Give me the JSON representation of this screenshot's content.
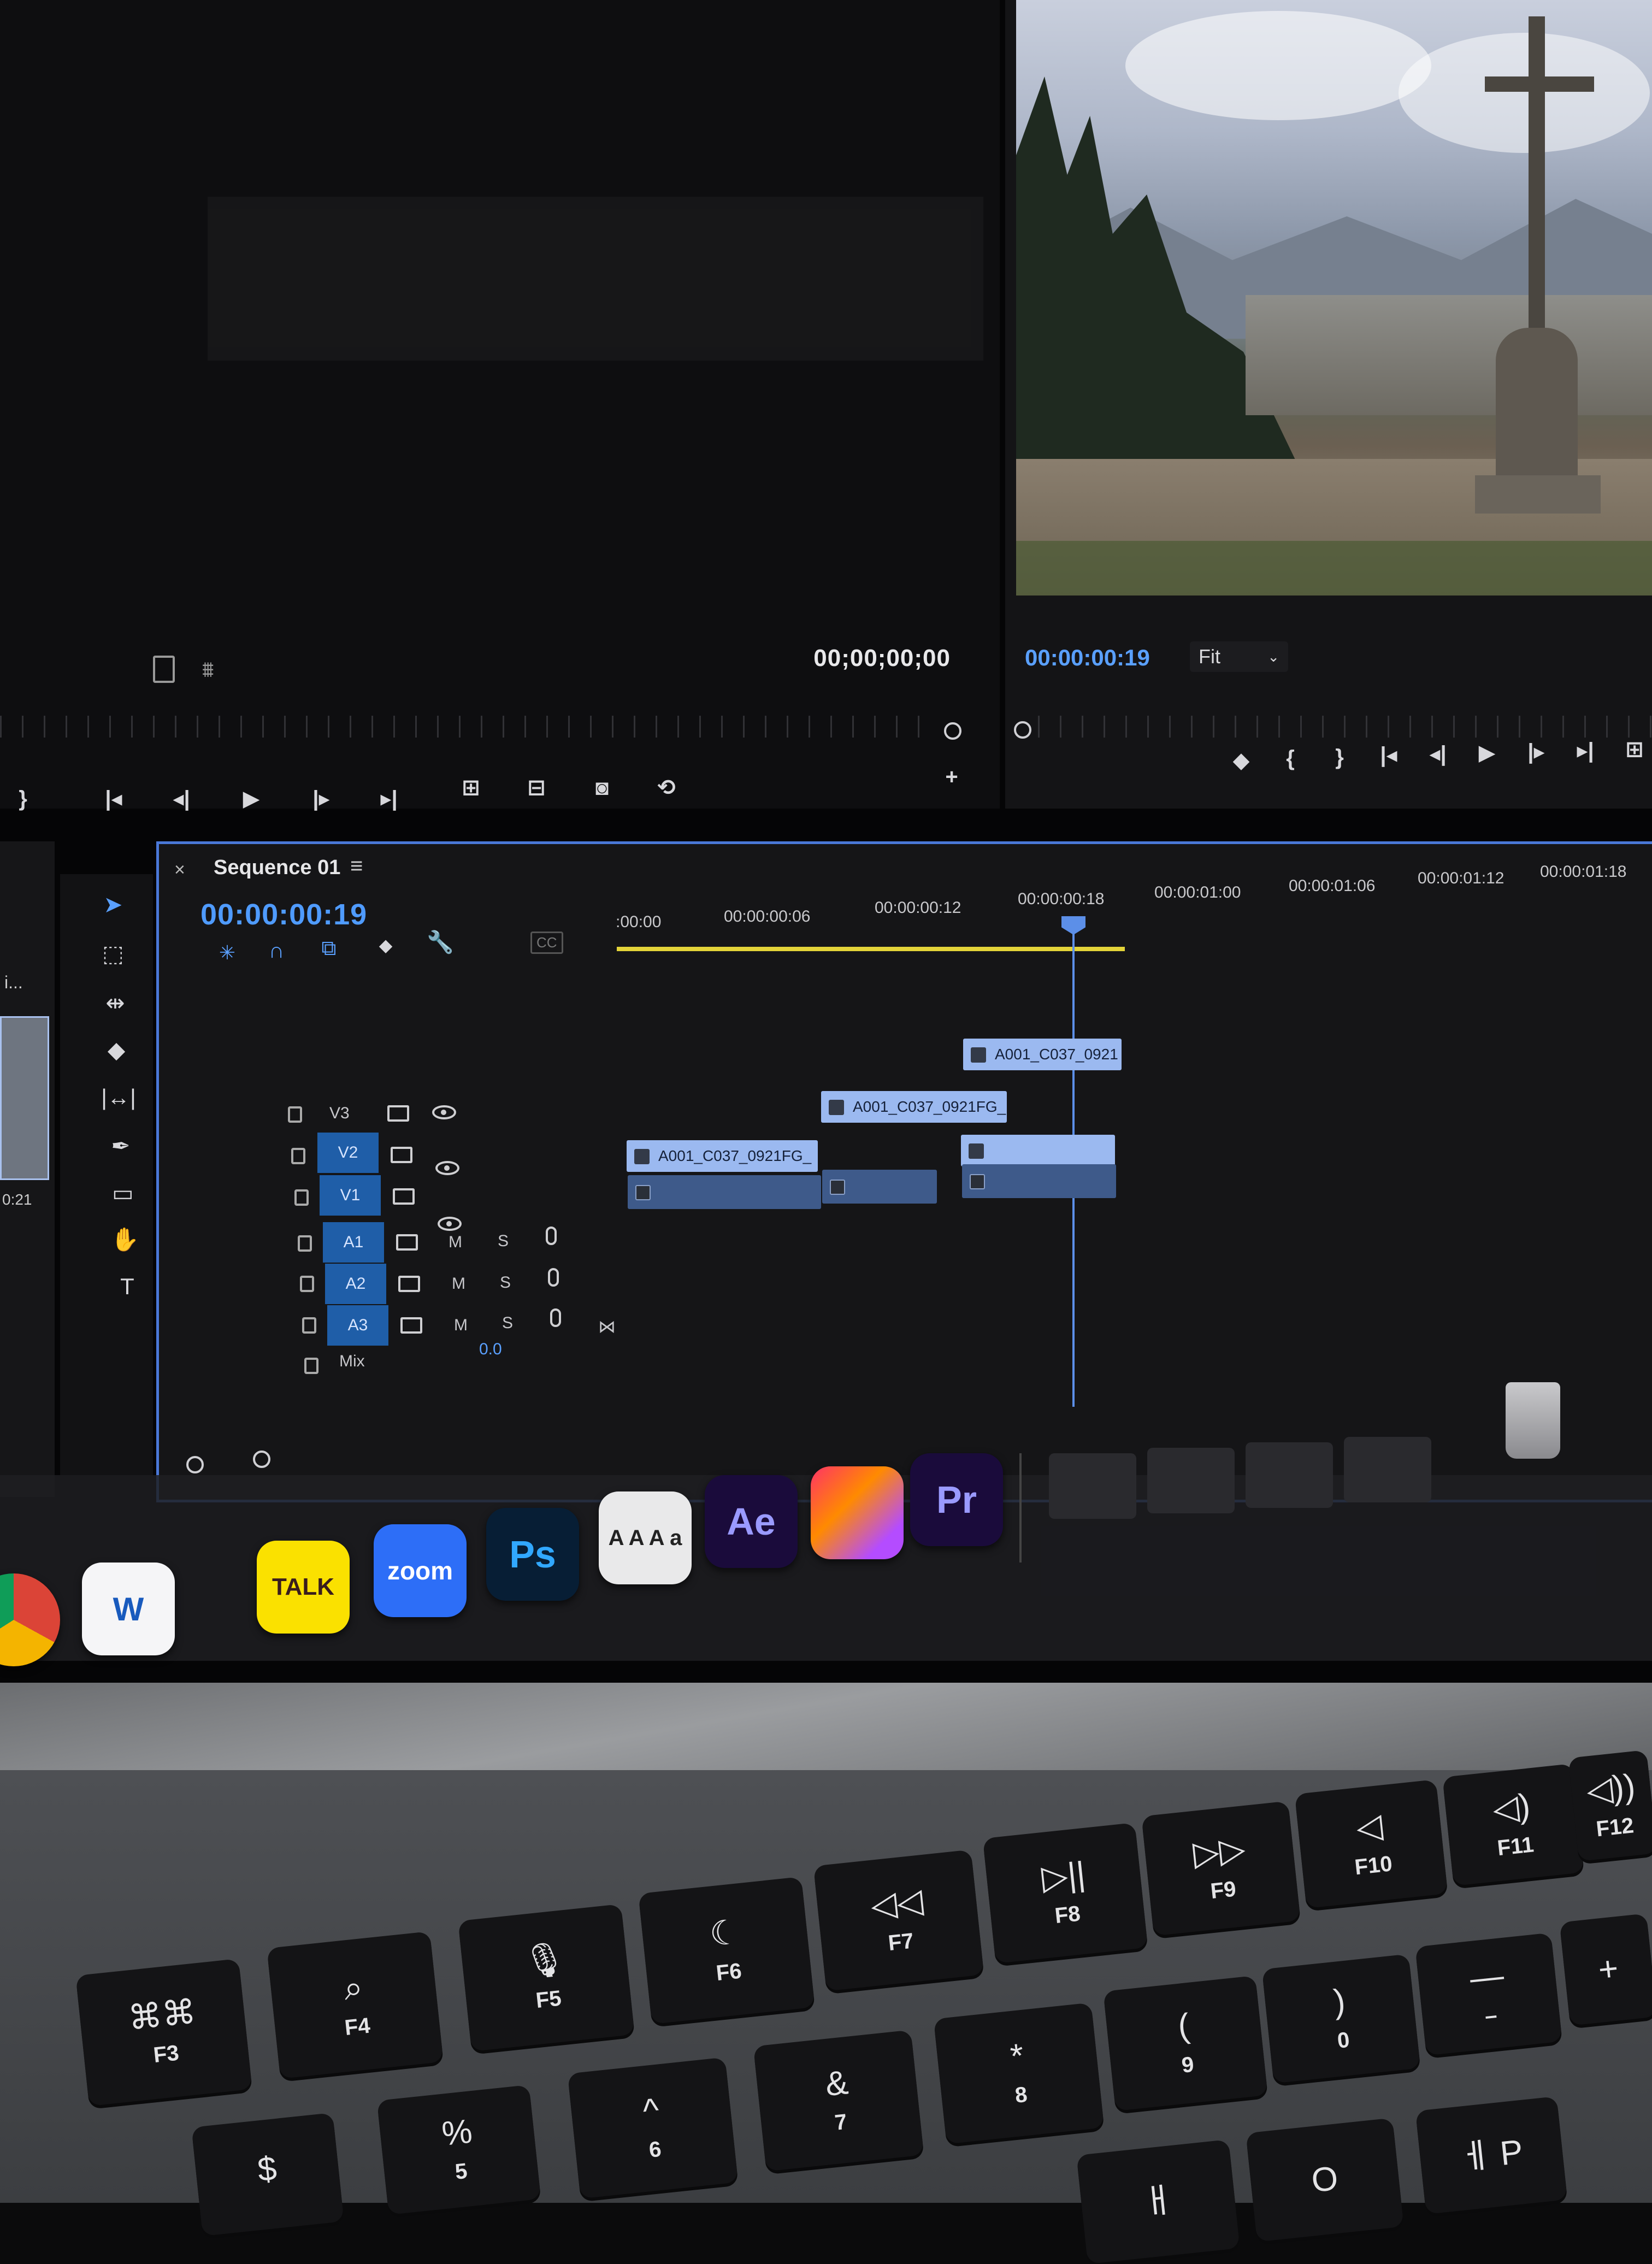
{
  "source_monitor": {
    "timecode": "00;00;00;00"
  },
  "program_monitor": {
    "timecode": "00:00:00:19",
    "fit_label": "Fit"
  },
  "sequence": {
    "title": "Sequence 01",
    "timecode": "00:00:00:19",
    "ruler": [
      ":00:00",
      "00:00:00:06",
      "00:00:00:12",
      "00:00:00:18",
      "00:00:01:00",
      "00:00:01:06",
      "00:00:01:12",
      "00:00:01:18"
    ],
    "cc_label": "CC",
    "video_tracks": [
      "V3",
      "V2",
      "V1"
    ],
    "audio_tracks": [
      "A1",
      "A2",
      "A3"
    ],
    "mute_label": "M",
    "solo_label": "S",
    "mix_label": "Mix",
    "mix_value": "0.0",
    "clips": {
      "v3": "A001_C037_0921",
      "v2": "A001_C037_0921FG_",
      "v1": "A001_C037_0921FG_"
    }
  },
  "project": {
    "partial_text": "i...",
    "partial_time": "0:21"
  },
  "dock": {
    "apps": [
      {
        "name": "chrome",
        "label": ""
      },
      {
        "name": "word",
        "label": "W"
      },
      {
        "name": "kakaotalk",
        "label": "TALK"
      },
      {
        "name": "zoom",
        "label": "zoom"
      },
      {
        "name": "photoshop",
        "label": "Ps"
      },
      {
        "name": "font-book",
        "label": "A A A a"
      },
      {
        "name": "after-effects",
        "label": "Ae"
      },
      {
        "name": "creative-cloud",
        "label": ""
      },
      {
        "name": "premiere-pro",
        "label": "Pr"
      }
    ]
  },
  "keyboard": {
    "fn_row": [
      {
        "sym": "⌘⌘",
        "lbl": "F3"
      },
      {
        "sym": "⌕",
        "lbl": "F4"
      },
      {
        "sym": "🎙",
        "lbl": "F5"
      },
      {
        "sym": "☾",
        "lbl": "F6"
      },
      {
        "sym": "◁◁",
        "lbl": "F7"
      },
      {
        "sym": "▷||",
        "lbl": "F8"
      },
      {
        "sym": "▷▷",
        "lbl": "F9"
      },
      {
        "sym": "◁",
        "lbl": "F10"
      },
      {
        "sym": "◁)",
        "lbl": "F11"
      },
      {
        "sym": "◁))",
        "lbl": "F12"
      }
    ],
    "num_row": [
      {
        "sym": "$",
        "lbl": ""
      },
      {
        "sym": "%",
        "lbl": "5"
      },
      {
        "sym": "^",
        "lbl": "6"
      },
      {
        "sym": "&",
        "lbl": "7"
      },
      {
        "sym": "*",
        "lbl": "8"
      },
      {
        "sym": "(",
        "lbl": "9"
      },
      {
        "sym": ")",
        "lbl": "0"
      },
      {
        "sym": "—",
        "lbl": "–"
      },
      {
        "sym": "+",
        "lbl": ""
      }
    ],
    "alpha": [
      "ㅐ",
      "O",
      "ㅔ P"
    ]
  },
  "colors": {
    "accent_blue": "#4f9bff",
    "clip_blue": "#9bb9f0",
    "work_area": "#e3d339",
    "panel_border": "#4a78d8"
  }
}
